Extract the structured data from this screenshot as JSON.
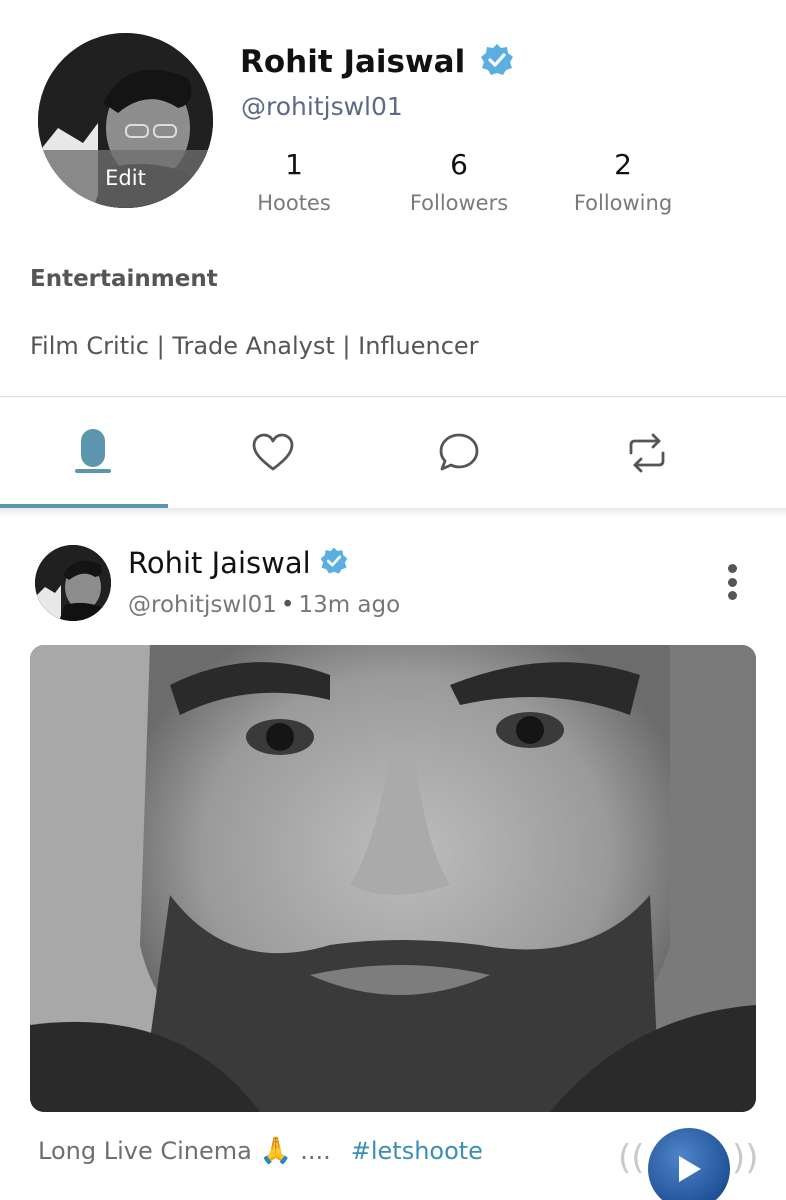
{
  "profile": {
    "name": "Rohit Jaiswal",
    "handle": "@rohitjswl01",
    "avatar_edit_label": "Edit",
    "category": "Entertainment",
    "bio": "Film Critic | Trade Analyst | Influencer",
    "stats": [
      {
        "value": "1",
        "label": "Hootes"
      },
      {
        "value": "6",
        "label": "Followers"
      },
      {
        "value": "2",
        "label": "Following"
      }
    ]
  },
  "tabs": [
    {
      "icon": "microphone-icon",
      "active": true
    },
    {
      "icon": "heart-icon",
      "active": false
    },
    {
      "icon": "comment-icon",
      "active": false
    },
    {
      "icon": "repost-icon",
      "active": false
    }
  ],
  "post": {
    "author_name": "Rohit Jaiswal",
    "author_handle": "@rohitjswl01",
    "separator": "•",
    "time": "13m ago",
    "caption_text": "Long Live Cinema",
    "caption_emoji": "🙏",
    "caption_ellipsis": "....",
    "hashtag": "#letshoote"
  },
  "colors": {
    "accent": "#5a96ad",
    "verified": "#5aaee0",
    "hashtag": "#3b8fb5",
    "play_button": "#1d4f93"
  }
}
